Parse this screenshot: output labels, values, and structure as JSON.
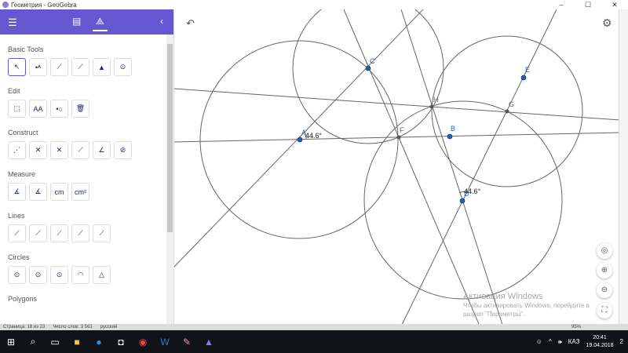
{
  "window": {
    "title": "Геометрия - GeoGebra",
    "min": "–",
    "max": "☐",
    "close": "✕"
  },
  "header": {
    "menu_icon": "☰",
    "doc_icon": "▤",
    "tools_icon": "⟁",
    "collapse_icon": "‹"
  },
  "tool_groups": [
    {
      "label": "Basic Tools",
      "count": 6
    },
    {
      "label": "Edit",
      "count": 4
    },
    {
      "label": "Construct",
      "count": 6
    },
    {
      "label": "Measure",
      "count": 4
    },
    {
      "label": "Lines",
      "count": 5
    },
    {
      "label": "Circles",
      "count": 5
    },
    {
      "label": "Polygons",
      "count": 0
    }
  ],
  "measure_labels": {
    "cm": "cm",
    "cm2": "cm²"
  },
  "edit_text_tool": "AA",
  "canvas": {
    "undo": "↶",
    "settings": "⚙",
    "points": {
      "A": "A",
      "B": "B",
      "C": "C",
      "D": "D",
      "E": "E",
      "F": "F",
      "G": "G",
      "H": "H"
    },
    "angle_A": "44.6°",
    "angle_D": "44.6°",
    "colors": {
      "free_point": "#1565c0",
      "dependent_point": "#444444",
      "line": "#666666"
    }
  },
  "view_buttons": {
    "home": "◎",
    "zoom_in": "⊕",
    "zoom_out": "⊖",
    "fullscreen": "⛶"
  },
  "activation": {
    "title": "Активация Windows",
    "line1": "Чтобы активировать Windows, перейдите в",
    "line2": "раздел \"Параметры\"."
  },
  "word_status": {
    "page": "Страница: 18 из 23",
    "words": "Число слов: 3 561",
    "lang": "русский",
    "zoom": "95%"
  },
  "taskbar": {
    "lang": "КАЗ",
    "time": "20:41",
    "date": "19.04.2018",
    "notifications": "2"
  }
}
